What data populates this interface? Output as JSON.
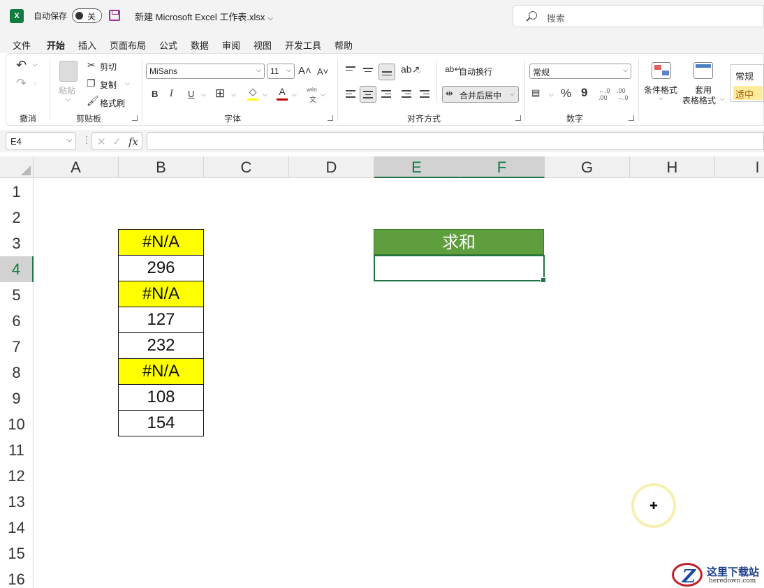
{
  "titlebar": {
    "logo": "X",
    "autosave_label": "自动保存",
    "autosave_state": "关",
    "document_title": "新建 Microsoft Excel 工作表.xlsx",
    "search_placeholder": "搜索"
  },
  "menu": {
    "tabs": [
      {
        "label": "文件"
      },
      {
        "label": "开始",
        "active": true
      },
      {
        "label": "插入"
      },
      {
        "label": "页面布局"
      },
      {
        "label": "公式"
      },
      {
        "label": "数据"
      },
      {
        "label": "审阅"
      },
      {
        "label": "视图"
      },
      {
        "label": "开发工具"
      },
      {
        "label": "帮助"
      }
    ]
  },
  "ribbon": {
    "undo_group": "撤消",
    "clipboard_group": "剪贴板",
    "paste_label": "粘贴",
    "cut_label": "剪切",
    "copy_label": "复制",
    "format_painter_label": "格式刷",
    "font_group": "字体",
    "font_name": "MiSans",
    "font_size": "11",
    "bold": "B",
    "italic": "I",
    "underline": "U",
    "font_color_glyph": "A",
    "phonetic_top": "wén",
    "phonetic_bottom": "文",
    "alignment_group": "对齐方式",
    "wrap_text_label": "自动换行",
    "merge_center_label": "合并后居中",
    "number_group": "数字",
    "number_format": "常规",
    "percent_glyph": "%",
    "comma_glyph": "9",
    "inc_decimal": "←.0 .00",
    "dec_decimal": ".00 →.0",
    "conditional_format_label": "条件格式",
    "table_format_label_1": "套用",
    "table_format_label_2": "表格格式",
    "style_normal": "常规",
    "style_neutral": "适中"
  },
  "formula_bar": {
    "name_box": "E4",
    "fx": "fx",
    "formula": ""
  },
  "grid": {
    "columns": [
      "A",
      "B",
      "C",
      "D",
      "E",
      "F",
      "G",
      "H",
      "I"
    ],
    "rows": [
      "1",
      "2",
      "3",
      "4",
      "5",
      "6",
      "7",
      "8",
      "9",
      "10",
      "11",
      "12",
      "13",
      "14",
      "15",
      "16"
    ],
    "selected_columns": [
      "E",
      "F"
    ],
    "selected_row": "4",
    "b_column_cells": [
      {
        "row": "3",
        "value": "#N/A",
        "error": true
      },
      {
        "row": "4",
        "value": "296",
        "error": false
      },
      {
        "row": "5",
        "value": "#N/A",
        "error": true
      },
      {
        "row": "6",
        "value": "127",
        "error": false
      },
      {
        "row": "7",
        "value": "232",
        "error": false
      },
      {
        "row": "8",
        "value": "#N/A",
        "error": true
      },
      {
        "row": "9",
        "value": "108",
        "error": false
      },
      {
        "row": "10",
        "value": "154",
        "error": false
      }
    ],
    "sum_header": "求和",
    "sum_value": ""
  },
  "colors": {
    "excel_green": "#217346",
    "header_green": "#5f9e3f",
    "error_yellow": "#ffff00"
  },
  "watermark": {
    "glyph": "Z",
    "cn": "这里下载站",
    "en": "heredown.com"
  }
}
